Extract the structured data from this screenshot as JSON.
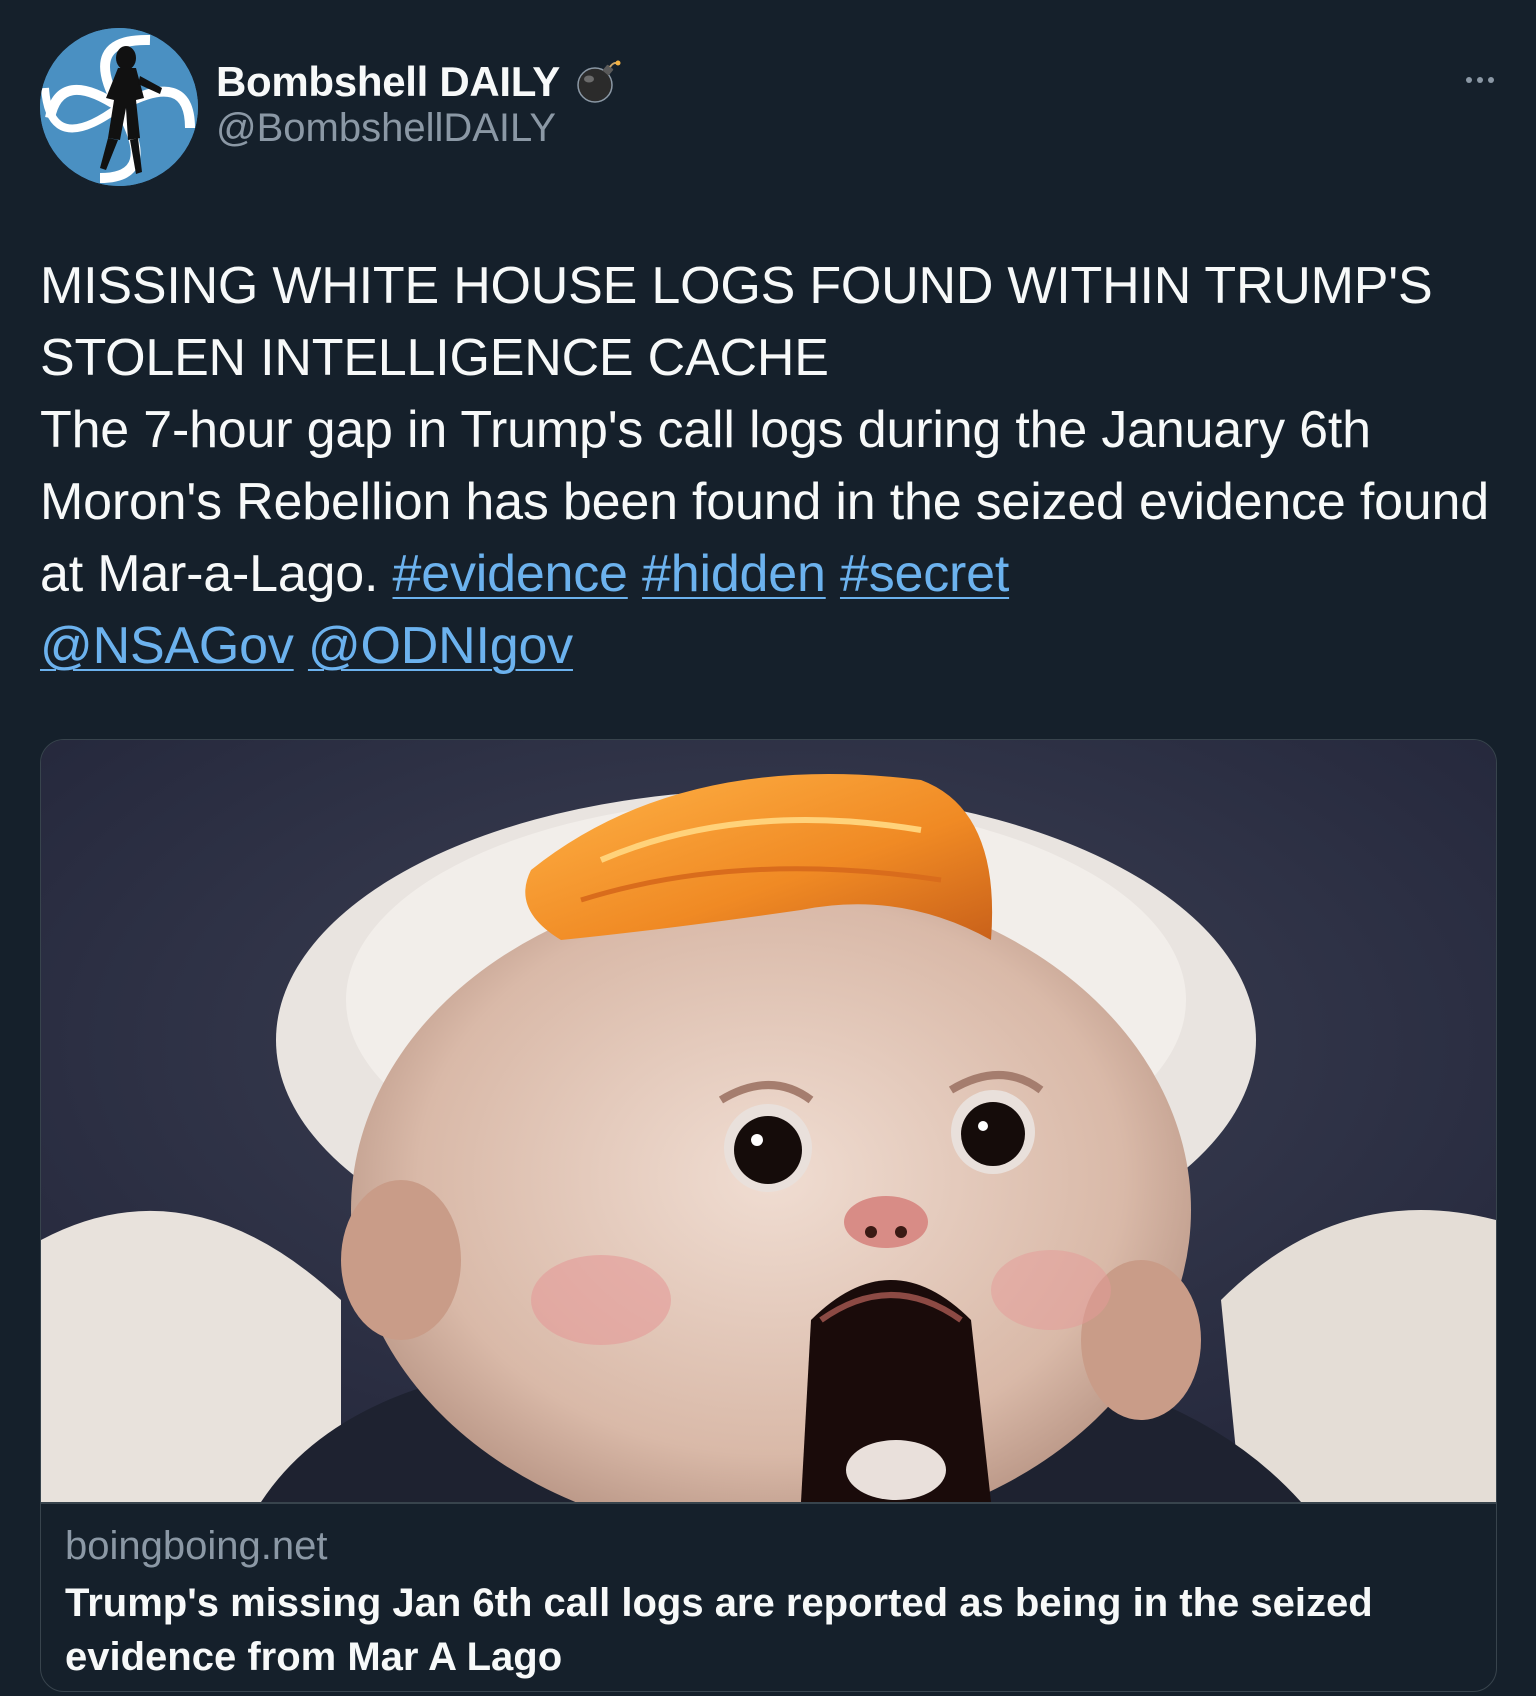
{
  "author": {
    "display_name": "Bombshell DAILY",
    "handle": "@BombshellDAILY",
    "badge_icon": "bomb-icon",
    "avatar_colors": {
      "primary": "#4a90c2",
      "secondary": "#ffffff"
    }
  },
  "menu": {
    "more_icon": "ellipsis-icon"
  },
  "tweet": {
    "headline_line1": "MISSING WHITE HOUSE LOGS FOUND WITHIN TRUMP'S",
    "headline_line2": "STOLEN INTELLIGENCE CACHE",
    "body": "The 7-hour gap in Trump's call logs during the January 6th Moron's Rebellion has been found in the seized evidence found at Mar-a-Lago.",
    "hashtags": [
      "#evidence",
      "#hidden",
      "#secret"
    ],
    "mentions": [
      "@NSAGov",
      "@ODNIgov"
    ]
  },
  "card": {
    "domain": "boingboing.net",
    "title": "Trump's missing Jan 6th call logs are reported as being in the seized evidence from Mar A Lago",
    "image_subject": "painting of a screaming baby with orange swept hair"
  },
  "colors": {
    "background": "#15202b",
    "text": "#f7f9f9",
    "secondary_text": "#8b98a5",
    "link": "#6cb2ee",
    "border": "#38444d"
  }
}
